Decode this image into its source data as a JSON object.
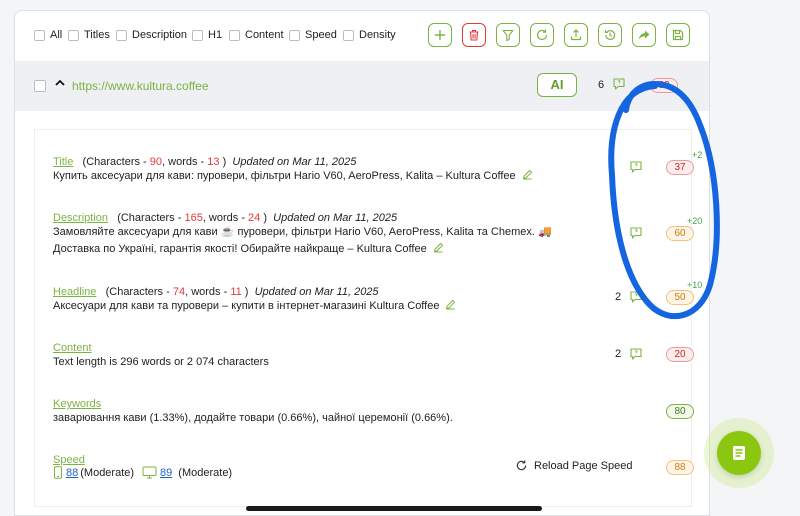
{
  "filters": [
    "All",
    "Titles",
    "Description",
    "H1",
    "Content",
    "Speed",
    "Density"
  ],
  "toolbar_icons": [
    "plus-icon",
    "trash-icon",
    "filter-icon",
    "refresh-icon",
    "upload-icon",
    "history-icon",
    "share-icon",
    "save-icon"
  ],
  "url_row": {
    "url": "https://www.kultura.coffee",
    "ai_label": "AI",
    "comment_count": "6",
    "score": "38"
  },
  "sections": {
    "title": {
      "label": "Title",
      "meta_prefix": "(Characters - ",
      "chars": "90",
      "meta_mid": ", words - ",
      "words": "13",
      "meta_suffix": " )",
      "updated": "Updated on Mar 11, 2025",
      "value": "Купить аксесуари для кави: пуровери, фільтри Hario V60, AeroPress, Kalita – Kultura Coffee",
      "score": "37",
      "delta": "+2"
    },
    "description": {
      "label": "Description",
      "meta_prefix": "(Characters - ",
      "chars": "165",
      "meta_mid": ", words - ",
      "words": "24",
      "meta_suffix": " )",
      "updated": "Updated on Mar 11, 2025",
      "value_line1": "Замовляйте аксесуари для кави ☕ пуровери, фільтри Hario V60, AeroPress, Kalita та Chemex. 🚚",
      "value_line2": "Доставка по Україні, гарантія якості! Обирайте найкраще – Kultura Coffee",
      "score": "60",
      "delta": "+20"
    },
    "headline": {
      "label": "Headline",
      "meta_prefix": "(Characters - ",
      "chars": "74",
      "meta_mid": ", words - ",
      "words": "11",
      "meta_suffix": " )",
      "updated": "Updated on Mar 11, 2025",
      "value": "Аксесуари для кави та пуровери – купити в інтернет-магазині Kultura Coffee",
      "comment_count": "2",
      "score": "50",
      "delta": "+10"
    },
    "content": {
      "label": "Content",
      "value": "Text length is 296 words or 2 074 characters",
      "comment_count": "2",
      "score": "20"
    },
    "keywords": {
      "label": "Keywords",
      "value": "заварювання кави (1.33%), додайте товари (0.66%), чайної церемонії (0.66%).",
      "score": "80"
    },
    "speed": {
      "label": "Speed",
      "mobile_score": "88",
      "mobile_status": "(Moderate)",
      "desktop_score": "89",
      "desktop_status": "(Moderate)",
      "reload_label": "Reload Page Speed",
      "score": "88"
    }
  },
  "colors": {
    "accent_green": "#7cb342",
    "danger_red": "#e53935",
    "annotation_blue": "#1565e0",
    "fab_green": "#8bc611"
  }
}
